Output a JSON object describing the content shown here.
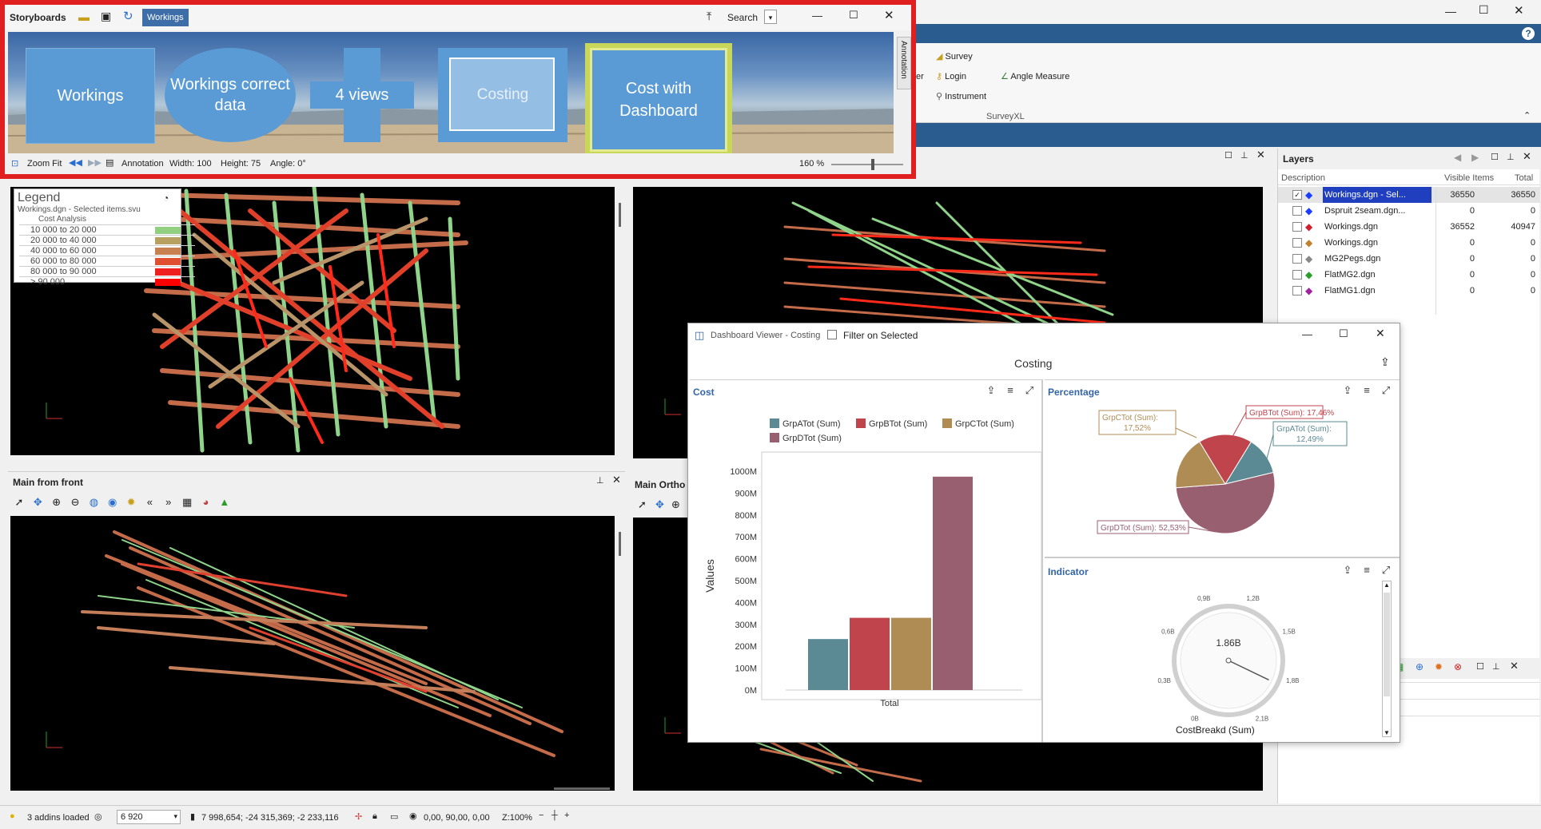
{
  "storyboard": {
    "title": "Storyboards",
    "active_tab": "Workings",
    "search_label": "Search",
    "annotation_side_label": "Annotation",
    "tiles": [
      {
        "label": "Workings"
      },
      {
        "label": "Workings correct data"
      },
      {
        "label": "4 views"
      },
      {
        "label": "Costing"
      },
      {
        "label": "Cost with Dashboard"
      }
    ],
    "footer": {
      "zoom_fit": "Zoom Fit",
      "annotation": "Annotation",
      "width": "Width: 100",
      "height": "Height: 75",
      "angle": "Angle: 0°",
      "zoom_percent": "160 %"
    }
  },
  "ribbon": {
    "survey": "Survey",
    "login": "Login",
    "instrument": "Instrument",
    "angle_measure": "Angle Measure",
    "group_label": "SurveyXL",
    "truncated_label": "er"
  },
  "views": {
    "top_left_legend": {
      "title": "Legend",
      "subtitle": "Workings.dgn - Selected items.svu",
      "analysis": "Cost Analysis",
      "rows": [
        {
          "label": "10 000 to 20 000",
          "color": "#90d080"
        },
        {
          "label": "20 000 to 40 000",
          "color": "#b8a060"
        },
        {
          "label": "40 000 to 60 000",
          "color": "#c88050"
        },
        {
          "label": "60 000 to 80 000",
          "color": "#e05030"
        },
        {
          "label": "80 000 to 90 000",
          "color": "#ee2020"
        },
        {
          "label": "> 90 000",
          "color": "#ff0000"
        }
      ]
    },
    "bottom_left_title": "Main from front",
    "bottom_right_title": "Main Ortho"
  },
  "layers": {
    "title": "Layers",
    "columns": [
      "Description",
      "Visible Items",
      "Total"
    ],
    "rows": [
      {
        "name": "Workings.dgn - Sel...",
        "visible": "36550",
        "total": "36550",
        "selected": true
      },
      {
        "name": "Dspruit 2seam.dgn...",
        "visible": "0",
        "total": "0"
      },
      {
        "name": "Workings.dgn",
        "visible": "36552",
        "total": "40947"
      },
      {
        "name": "Workings.dgn",
        "visible": "0",
        "total": "0"
      },
      {
        "name": "MG2Pegs.dgn",
        "visible": "0",
        "total": "0"
      },
      {
        "name": "FlatMG2.dgn",
        "visible": "0",
        "total": "0"
      },
      {
        "name": "FlatMG1.dgn",
        "visible": "0",
        "total": "0"
      }
    ]
  },
  "dashboard": {
    "window_title": "Dashboard Viewer - Costing",
    "filter_label": "Filter on Selected",
    "header": "Costing",
    "cost_title": "Cost",
    "percentage_title": "Percentage",
    "indicator_title": "Indicator",
    "gauge": {
      "value_label": "1.86B",
      "caption": "CostBreakd (Sum)",
      "ticks": [
        "0B",
        "0,3B",
        "0,6B",
        "0,9B",
        "1,2B",
        "1,5B",
        "1,8B",
        "2,1B"
      ],
      "value": 1.86,
      "max": 2.1
    },
    "pie_labels": [
      "GrpCTot (Sum): 17,52%",
      "GrpBTot (Sum): 17,46%",
      "GrpATot (Sum): 12,49%",
      "GrpDTot (Sum): 52,53%"
    ]
  },
  "chart_data": [
    {
      "type": "bar",
      "categories": [
        "Total"
      ],
      "series": [
        {
          "name": "GrpATot (Sum)",
          "values": [
            233
          ],
          "color": "#5b8a94"
        },
        {
          "name": "GrpBTot (Sum)",
          "values": [
            330
          ],
          "color": "#c0444c"
        },
        {
          "name": "GrpCTot (Sum)",
          "values": [
            330
          ],
          "color": "#b08c55"
        },
        {
          "name": "GrpDTot (Sum)",
          "values": [
            975
          ],
          "color": "#985f70"
        }
      ],
      "ylabel": "Values",
      "yticks": [
        "0M",
        "100M",
        "200M",
        "300M",
        "400M",
        "500M",
        "600M",
        "700M",
        "800M",
        "900M",
        "1000M"
      ],
      "ylim": [
        0,
        1050
      ],
      "legend": "top"
    },
    {
      "type": "pie",
      "series": [
        {
          "name": "GrpATot (Sum)",
          "value": 12.49,
          "color": "#5b8a94"
        },
        {
          "name": "GrpBTot (Sum)",
          "value": 17.46,
          "color": "#c0444c"
        },
        {
          "name": "GrpCTot (Sum)",
          "value": 17.52,
          "color": "#b08c55"
        },
        {
          "name": "GrpDTot (Sum)",
          "value": 52.53,
          "color": "#985f70"
        }
      ]
    }
  ],
  "status": {
    "addins": "3 addins loaded",
    "scale": "6 920",
    "coords": "7 998,654; -24 315,369; -2 233,116",
    "view_angles": "0,00, 90,00, 0,00",
    "zoom": "Z:100%"
  }
}
